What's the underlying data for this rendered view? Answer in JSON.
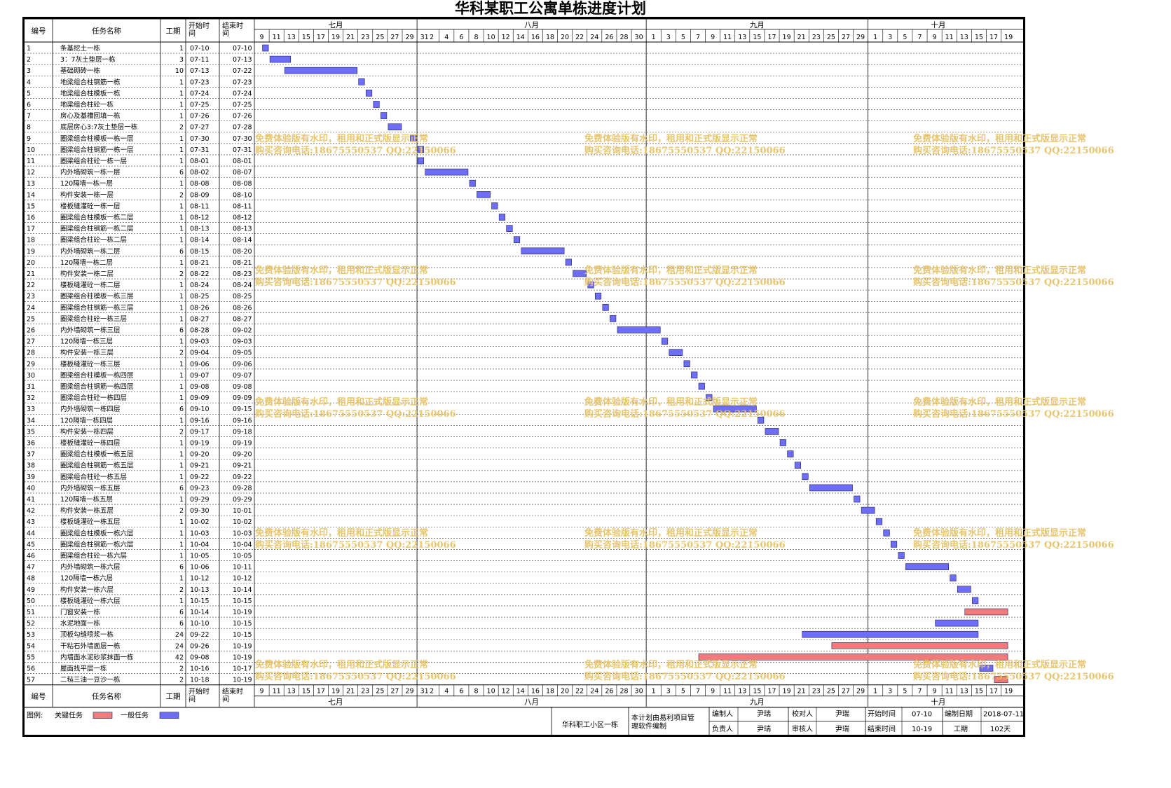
{
  "title": "华科某职工公寓单栋进度计划",
  "headers": {
    "id": "编号",
    "name": "任务名称",
    "duration": "工期",
    "start": "开始时间",
    "end": "结束时间"
  },
  "months": [
    "七月",
    "八月",
    "九月",
    "十月"
  ],
  "day_ticks": [
    [
      9,
      11,
      13,
      15,
      17,
      19,
      21,
      23,
      25,
      27,
      29,
      31
    ],
    [
      2,
      4,
      6,
      8,
      10,
      12,
      14,
      16,
      18,
      20,
      22,
      24,
      26,
      28,
      30
    ],
    [
      1,
      3,
      5,
      7,
      9,
      11,
      13,
      15,
      17,
      19,
      21,
      23,
      25,
      27,
      29
    ],
    [
      1,
      3,
      5,
      7,
      9,
      11,
      13,
      15,
      17,
      19
    ]
  ],
  "colors": {
    "critical": "#ef7b7b",
    "normal": "#6d6df5",
    "watermark": "#e6c267"
  },
  "tasks": [
    {
      "id": "1",
      "name": "条基挖土一栋",
      "duration": "1",
      "start": "07-10",
      "end": "07-10",
      "critical": false
    },
    {
      "id": "2",
      "name": "3：7灰土垫层一栋",
      "duration": "3",
      "start": "07-11",
      "end": "07-13",
      "critical": false
    },
    {
      "id": "3",
      "name": "基础砌砖一栋",
      "duration": "10",
      "start": "07-13",
      "end": "07-22",
      "critical": false
    },
    {
      "id": "4",
      "name": "地梁组合柱钢筋一栋",
      "duration": "1",
      "start": "07-23",
      "end": "07-23",
      "critical": false
    },
    {
      "id": "5",
      "name": "地梁组合柱模板一栋",
      "duration": "1",
      "start": "07-24",
      "end": "07-24",
      "critical": false
    },
    {
      "id": "6",
      "name": "地梁组合柱砼一栋",
      "duration": "1",
      "start": "07-25",
      "end": "07-25",
      "critical": false
    },
    {
      "id": "7",
      "name": "房心及基槽回填一栋",
      "duration": "1",
      "start": "07-26",
      "end": "07-26",
      "critical": false
    },
    {
      "id": "8",
      "name": "底层房心3:7灰土垫层一栋",
      "duration": "2",
      "start": "07-27",
      "end": "07-28",
      "critical": false
    },
    {
      "id": "9",
      "name": "圈梁组合柱模板一栋一层",
      "duration": "1",
      "start": "07-30",
      "end": "07-30",
      "critical": false
    },
    {
      "id": "10",
      "name": "圈梁组合柱钢筋一栋一层",
      "duration": "1",
      "start": "07-31",
      "end": "07-31",
      "critical": false
    },
    {
      "id": "11",
      "name": "圈梁组合柱砼一栋一层",
      "duration": "1",
      "start": "08-01",
      "end": "08-01",
      "critical": false
    },
    {
      "id": "12",
      "name": "内外墙砌筑一栋一层",
      "duration": "6",
      "start": "08-02",
      "end": "08-07",
      "critical": false
    },
    {
      "id": "13",
      "name": "120隔墙一栋一层",
      "duration": "1",
      "start": "08-08",
      "end": "08-08",
      "critical": false
    },
    {
      "id": "14",
      "name": "构件安装一栋一层",
      "duration": "2",
      "start": "08-09",
      "end": "08-10",
      "critical": false
    },
    {
      "id": "15",
      "name": "楼板缝灌砼一栋一层",
      "duration": "1",
      "start": "08-11",
      "end": "08-11",
      "critical": false
    },
    {
      "id": "16",
      "name": "圈梁组合柱模板一栋二层",
      "duration": "1",
      "start": "08-12",
      "end": "08-12",
      "critical": false
    },
    {
      "id": "17",
      "name": "圈梁组合柱钢筋一栋二层",
      "duration": "1",
      "start": "08-13",
      "end": "08-13",
      "critical": false
    },
    {
      "id": "18",
      "name": "圈梁组合柱砼一栋二层",
      "duration": "1",
      "start": "08-14",
      "end": "08-14",
      "critical": false
    },
    {
      "id": "19",
      "name": "内外墙砌筑一栋二层",
      "duration": "6",
      "start": "08-15",
      "end": "08-20",
      "critical": false
    },
    {
      "id": "20",
      "name": "120隔墙一栋二层",
      "duration": "1",
      "start": "08-21",
      "end": "08-21",
      "critical": false
    },
    {
      "id": "21",
      "name": "构件安装一栋二层",
      "duration": "2",
      "start": "08-22",
      "end": "08-23",
      "critical": false
    },
    {
      "id": "22",
      "name": "楼板缝灌砼一栋二层",
      "duration": "1",
      "start": "08-24",
      "end": "08-24",
      "critical": false
    },
    {
      "id": "23",
      "name": "圈梁组合柱模板一栋三层",
      "duration": "1",
      "start": "08-25",
      "end": "08-25",
      "critical": false
    },
    {
      "id": "24",
      "name": "圈梁组合柱钢筋一栋三层",
      "duration": "1",
      "start": "08-26",
      "end": "08-26",
      "critical": false
    },
    {
      "id": "25",
      "name": "圈梁组合柱砼一栋三层",
      "duration": "1",
      "start": "08-27",
      "end": "08-27",
      "critical": false
    },
    {
      "id": "26",
      "name": "内外墙砌筑一栋三层",
      "duration": "6",
      "start": "08-28",
      "end": "09-02",
      "critical": false
    },
    {
      "id": "27",
      "name": "120隔墙一栋三层",
      "duration": "1",
      "start": "09-03",
      "end": "09-03",
      "critical": false
    },
    {
      "id": "28",
      "name": "构件安装一栋三层",
      "duration": "2",
      "start": "09-04",
      "end": "09-05",
      "critical": false
    },
    {
      "id": "29",
      "name": "楼板缝灌砼一栋三层",
      "duration": "1",
      "start": "09-06",
      "end": "09-06",
      "critical": false
    },
    {
      "id": "30",
      "name": "圈梁组合柱模板一栋四层",
      "duration": "1",
      "start": "09-07",
      "end": "09-07",
      "critical": false
    },
    {
      "id": "31",
      "name": "圈梁组合柱钢筋一栋四层",
      "duration": "1",
      "start": "09-08",
      "end": "09-08",
      "critical": false
    },
    {
      "id": "32",
      "name": "圈梁组合柱砼一栋四层",
      "duration": "1",
      "start": "09-09",
      "end": "09-09",
      "critical": false
    },
    {
      "id": "33",
      "name": "内外墙砌筑一栋四层",
      "duration": "6",
      "start": "09-10",
      "end": "09-15",
      "critical": false
    },
    {
      "id": "34",
      "name": "120隔墙一栋四层",
      "duration": "1",
      "start": "09-16",
      "end": "09-16",
      "critical": false
    },
    {
      "id": "35",
      "name": "构件安装一栋四层",
      "duration": "2",
      "start": "09-17",
      "end": "09-18",
      "critical": false
    },
    {
      "id": "36",
      "name": "楼板缝灌砼一栋四层",
      "duration": "1",
      "start": "09-19",
      "end": "09-19",
      "critical": false
    },
    {
      "id": "37",
      "name": "圈梁组合柱模板一栋五层",
      "duration": "1",
      "start": "09-20",
      "end": "09-20",
      "critical": false
    },
    {
      "id": "38",
      "name": "圈梁组合柱钢筋一栋五层",
      "duration": "1",
      "start": "09-21",
      "end": "09-21",
      "critical": false
    },
    {
      "id": "39",
      "name": "圈梁组合柱砼一栋五层",
      "duration": "1",
      "start": "09-22",
      "end": "09-22",
      "critical": false
    },
    {
      "id": "40",
      "name": "内外墙砌筑一栋五层",
      "duration": "6",
      "start": "09-23",
      "end": "09-28",
      "critical": false
    },
    {
      "id": "41",
      "name": "120隔墙一栋五层",
      "duration": "1",
      "start": "09-29",
      "end": "09-29",
      "critical": false
    },
    {
      "id": "42",
      "name": "构件安装一栋五层",
      "duration": "2",
      "start": "09-30",
      "end": "10-01",
      "critical": false
    },
    {
      "id": "43",
      "name": "楼板缝灌砼一栋五层",
      "duration": "1",
      "start": "10-02",
      "end": "10-02",
      "critical": false
    },
    {
      "id": "44",
      "name": "圈梁组合柱模板一栋六层",
      "duration": "1",
      "start": "10-03",
      "end": "10-03",
      "critical": false
    },
    {
      "id": "45",
      "name": "圈梁组合柱钢筋一栋六层",
      "duration": "1",
      "start": "10-04",
      "end": "10-04",
      "critical": false
    },
    {
      "id": "46",
      "name": "圈梁组合柱砼一栋六层",
      "duration": "1",
      "start": "10-05",
      "end": "10-05",
      "critical": false
    },
    {
      "id": "47",
      "name": "内外墙砌筑一栋六层",
      "duration": "6",
      "start": "10-06",
      "end": "10-11",
      "critical": false
    },
    {
      "id": "48",
      "name": "120隔墙一栋六层",
      "duration": "1",
      "start": "10-12",
      "end": "10-12",
      "critical": false
    },
    {
      "id": "49",
      "name": "构件安装一栋六层",
      "duration": "2",
      "start": "10-13",
      "end": "10-14",
      "critical": false
    },
    {
      "id": "50",
      "name": "楼板缝灌砼一栋六层",
      "duration": "1",
      "start": "10-15",
      "end": "10-15",
      "critical": false
    },
    {
      "id": "51",
      "name": "门窗安装一栋",
      "duration": "6",
      "start": "10-14",
      "end": "10-19",
      "critical": true
    },
    {
      "id": "52",
      "name": "水泥地面一栋",
      "duration": "6",
      "start": "10-10",
      "end": "10-15",
      "critical": false
    },
    {
      "id": "53",
      "name": "顶板勾缝喷浆一栋",
      "duration": "24",
      "start": "09-22",
      "end": "10-15",
      "critical": false
    },
    {
      "id": "54",
      "name": "干粘石外墙面层一栋",
      "duration": "24",
      "start": "09-26",
      "end": "10-19",
      "critical": true
    },
    {
      "id": "55",
      "name": "内墙面水泥砂浆抹面一栋",
      "duration": "42",
      "start": "09-08",
      "end": "10-19",
      "critical": true
    },
    {
      "id": "56",
      "name": "屋面找平层一栋",
      "duration": "2",
      "start": "10-16",
      "end": "10-17",
      "critical": false
    },
    {
      "id": "57",
      "name": "二毡三油一豆沙一栋",
      "duration": "2",
      "start": "10-18",
      "end": "10-19",
      "critical": true
    }
  ],
  "legend": {
    "label": "图例:",
    "critical_label": "关键任务",
    "normal_label": "一般任务"
  },
  "footer": {
    "project": "华科职工小区一栋",
    "note": "本计划由易利项目管理软件编制",
    "compiler_label": "编制人",
    "compiler": "尹瑞",
    "checker_label": "校对人",
    "checker": "尹瑞",
    "start_label": "开始时间",
    "start": "07-10",
    "date_label": "编制日期",
    "date": "2018-07-11",
    "manager_label": "负责人",
    "manager": "尹瑞",
    "reviewer_label": "审核人",
    "reviewer": "尹瑞",
    "end_label": "结束时间",
    "end": "10-19",
    "duration_label": "工期",
    "duration": "102天"
  },
  "watermark": {
    "line1": "免费体验版有水印，租用和正式版显示正常",
    "line2": "购买咨询电话:18675550537 QQ:22150066"
  }
}
